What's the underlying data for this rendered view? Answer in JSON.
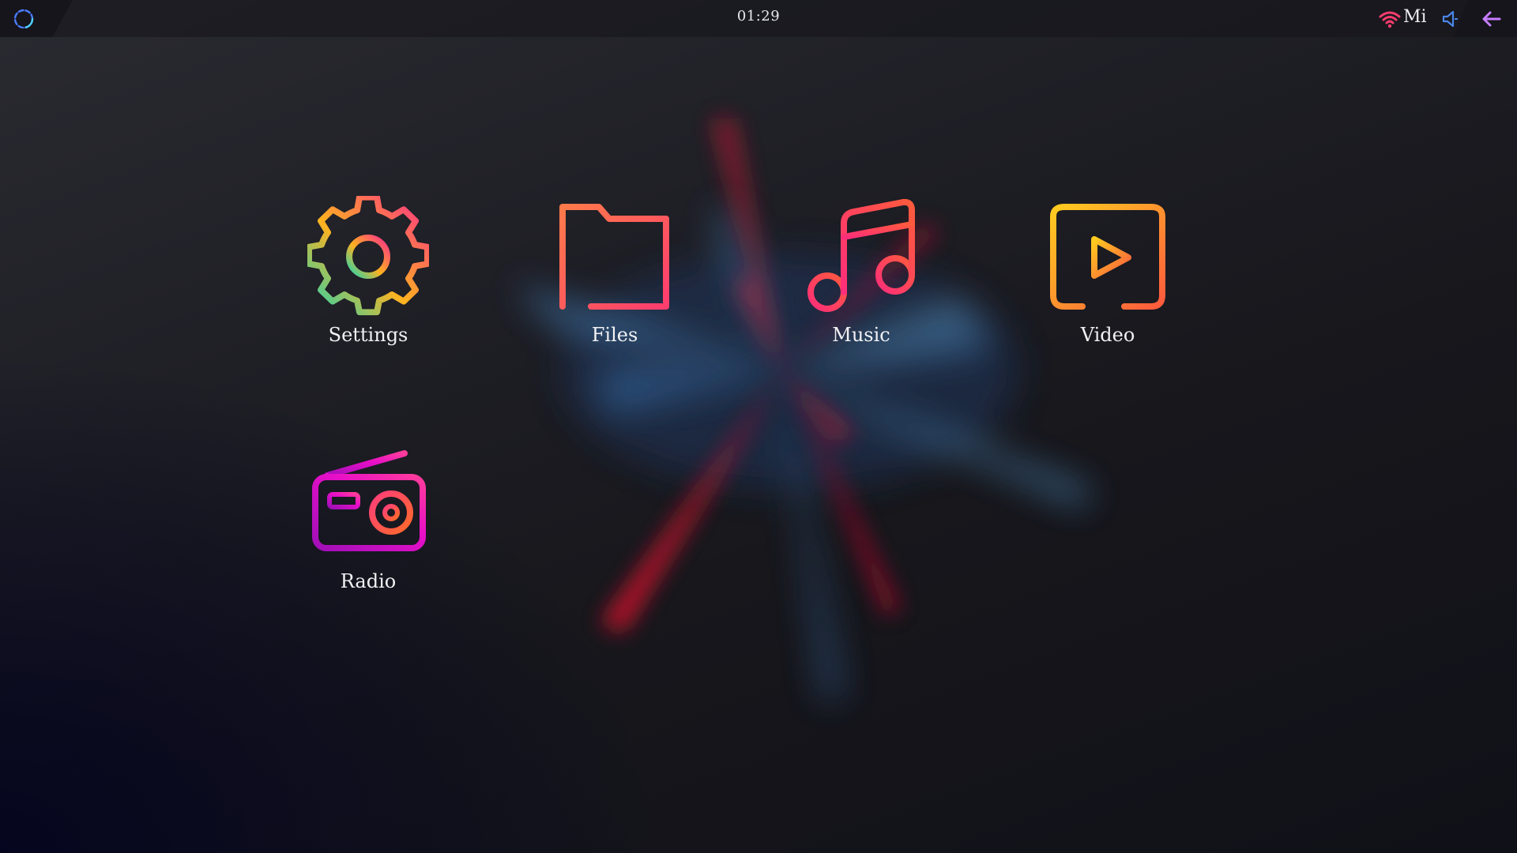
{
  "topbar": {
    "clock": "01:29",
    "network_label": "Mi",
    "icons": [
      "loading-spinner-icon",
      "wifi-icon",
      "volume-icon",
      "back-arrow-icon"
    ]
  },
  "apps": [
    {
      "label": "Settings",
      "icon": "gear-icon"
    },
    {
      "label": "Files",
      "icon": "folder-icon"
    },
    {
      "label": "Music",
      "icon": "music-note-icon"
    },
    {
      "label": "Video",
      "icon": "video-play-icon"
    },
    {
      "label": "Radio",
      "icon": "radio-icon"
    }
  ],
  "colors": {
    "background": "#1e1e25",
    "text": "#f1f1f4",
    "accent_pink": "#ff2e86",
    "accent_orange": "#ff6a3d",
    "accent_yellow": "#ffcc1f",
    "accent_magenta": "#d60fd0"
  }
}
